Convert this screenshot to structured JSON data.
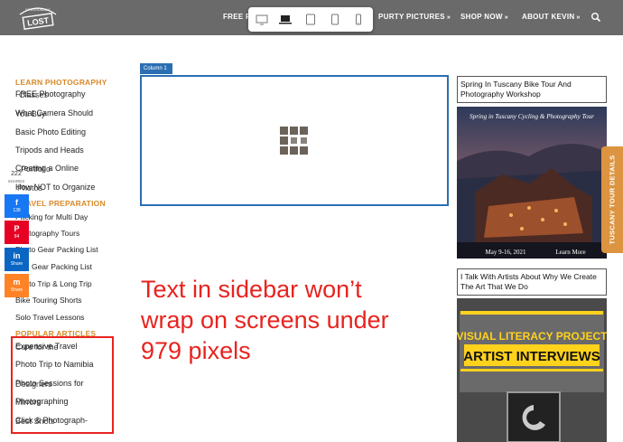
{
  "header": {
    "logo_text": "INTENTIONALLY LOST",
    "nav": [
      {
        "label": "FREE P",
        "chevron": false
      },
      {
        "label": "PURTY PICTURES",
        "chevron": true
      },
      {
        "label": "SHOP NOW",
        "chevron": true
      },
      {
        "label": "ABOUT KEVIN",
        "chevron": true
      }
    ],
    "search_icon": "search-icon"
  },
  "device_bar": {
    "devices": [
      "desktop-icon",
      "laptop-icon",
      "tablet-landscape-icon",
      "tablet-portrait-icon",
      "phone-icon"
    ],
    "active": "laptop-icon"
  },
  "sidebar": {
    "learn_heading": "LEARN PHOTOGRAPHY",
    "learn_items": [
      {
        "label": "FREE Photography",
        "overlap": "Classes"
      },
      {
        "label": "What Camera Should",
        "overlap": "You Buy"
      },
      {
        "label": "Basic Photo Editing",
        "overlap": ""
      },
      {
        "label": "Tripods and Heads",
        "overlap": ""
      },
      {
        "label": "Creating a Online",
        "overlap": "Portfolio"
      },
      {
        "label": "How NOT to Organize",
        "overlap": "Photos"
      }
    ],
    "travel_heading": "TRAVEL PREPARATION",
    "travel_items": [
      {
        "label": "Packing for Multi Day",
        "overlap": ""
      },
      {
        "label": "Photography Tours",
        "overlap": ""
      },
      {
        "label": "Photo Gear Packing List",
        "overlap": ""
      },
      {
        "label": "Non Gear Packing List",
        "overlap": ""
      },
      {
        "label": "Photo Trip & Long Trip",
        "overlap": ""
      },
      {
        "label": "Bike Touring Shorts",
        "overlap": ""
      },
      {
        "label": "Solo Travel Lessons",
        "overlap": ""
      }
    ],
    "popular_heading": "POPULAR ARTICLES",
    "popular_items": [
      {
        "label": "Expensive Travel",
        "overlap": "Cure for the"
      },
      {
        "label": "Photo Trip to Namibia",
        "overlap": ""
      },
      {
        "label": "Photo Sessions for",
        "overlap": "Designers"
      },
      {
        "label": "Photographing",
        "overlap": "Mirrors"
      },
      {
        "label": "Click & Photograph-",
        "overlap": "Best Shots"
      }
    ]
  },
  "share": {
    "total": "222",
    "total_label": "SHARES",
    "buttons": [
      {
        "network": "facebook",
        "glyph": "f",
        "count": "138",
        "color": "#1877f2"
      },
      {
        "network": "pinterest",
        "glyph": "P",
        "count": "84",
        "color": "#e60023"
      },
      {
        "network": "linkedin",
        "glyph": "in",
        "count": "Share",
        "color": "#0a66c2"
      },
      {
        "network": "mix",
        "glyph": "m",
        "count": "Share",
        "color": "#ff8226"
      }
    ]
  },
  "editor": {
    "column_label": "Column 1",
    "note": "Text in sidebar won’t wrap on screens under 979 pixels"
  },
  "right_column": {
    "card1_title": "Spring In Tuscany Bike Tour And Photography Workshop",
    "card1_banner": "Spring in Tuscany Cycling & Photography Tour",
    "card1_dates": "May 9-16, 2021",
    "card1_cta": "Learn More",
    "card2_title": "I Talk With Artists About Why We Create The Art That We Do",
    "card2_banner_top": "VISUAL LITERACY PROJECT",
    "card2_banner_main": "ARTIST INTERVIEWS"
  },
  "side_tab": {
    "label": "TUSCANY TOUR DETAILS"
  },
  "colors": {
    "accent_orange": "#d98a2b",
    "editor_blue": "#2b6fb3",
    "annotation_red": "#e8231f",
    "header_gray": "#6a6a6a"
  }
}
